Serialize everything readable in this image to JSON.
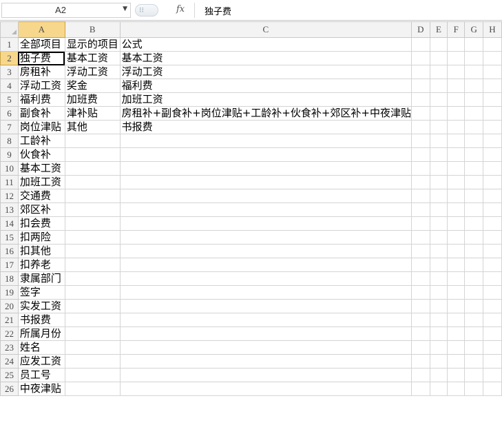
{
  "formula_bar": {
    "name_box": "A2",
    "fx_label": "fx",
    "formula_value": "独子费"
  },
  "columns": [
    "A",
    "B",
    "C",
    "D",
    "E",
    "F",
    "G",
    "H"
  ],
  "rows": [
    {
      "n": "1",
      "a": "全部项目",
      "b": "显示的项目",
      "c": "公式"
    },
    {
      "n": "2",
      "a": "独子费",
      "b": "基本工资",
      "c": "基本工资"
    },
    {
      "n": "3",
      "a": "房租补",
      "b": "浮动工资",
      "c": "浮动工资"
    },
    {
      "n": "4",
      "a": "浮动工资",
      "b": "奖金",
      "c": "福利费"
    },
    {
      "n": "5",
      "a": "福利费",
      "b": "加班费",
      "c": "加班工资"
    },
    {
      "n": "6",
      "a": "副食补",
      "b": "津补贴",
      "c": "房租补+副食补+岗位津贴+工龄补+伙食补+郊区补+中夜津贴"
    },
    {
      "n": "7",
      "a": "岗位津贴",
      "b": "其他",
      "c": "书报费"
    },
    {
      "n": "8",
      "a": "工龄补",
      "b": "",
      "c": ""
    },
    {
      "n": "9",
      "a": "伙食补",
      "b": "",
      "c": ""
    },
    {
      "n": "10",
      "a": "基本工资",
      "b": "",
      "c": ""
    },
    {
      "n": "11",
      "a": "加班工资",
      "b": "",
      "c": ""
    },
    {
      "n": "12",
      "a": "交通费",
      "b": "",
      "c": ""
    },
    {
      "n": "13",
      "a": "郊区补",
      "b": "",
      "c": ""
    },
    {
      "n": "14",
      "a": "扣会费",
      "b": "",
      "c": ""
    },
    {
      "n": "15",
      "a": "扣两险",
      "b": "",
      "c": ""
    },
    {
      "n": "16",
      "a": "扣其他",
      "b": "",
      "c": ""
    },
    {
      "n": "17",
      "a": "扣养老",
      "b": "",
      "c": ""
    },
    {
      "n": "18",
      "a": "隶属部门",
      "b": "",
      "c": ""
    },
    {
      "n": "19",
      "a": "签字",
      "b": "",
      "c": ""
    },
    {
      "n": "20",
      "a": "实发工资",
      "b": "",
      "c": ""
    },
    {
      "n": "21",
      "a": "书报费",
      "b": "",
      "c": ""
    },
    {
      "n": "22",
      "a": "所属月份",
      "b": "",
      "c": ""
    },
    {
      "n": "23",
      "a": "姓名",
      "b": "",
      "c": ""
    },
    {
      "n": "24",
      "a": "应发工资",
      "b": "",
      "c": ""
    },
    {
      "n": "25",
      "a": "员工号",
      "b": "",
      "c": ""
    },
    {
      "n": "26",
      "a": "中夜津贴",
      "b": "",
      "c": ""
    }
  ]
}
